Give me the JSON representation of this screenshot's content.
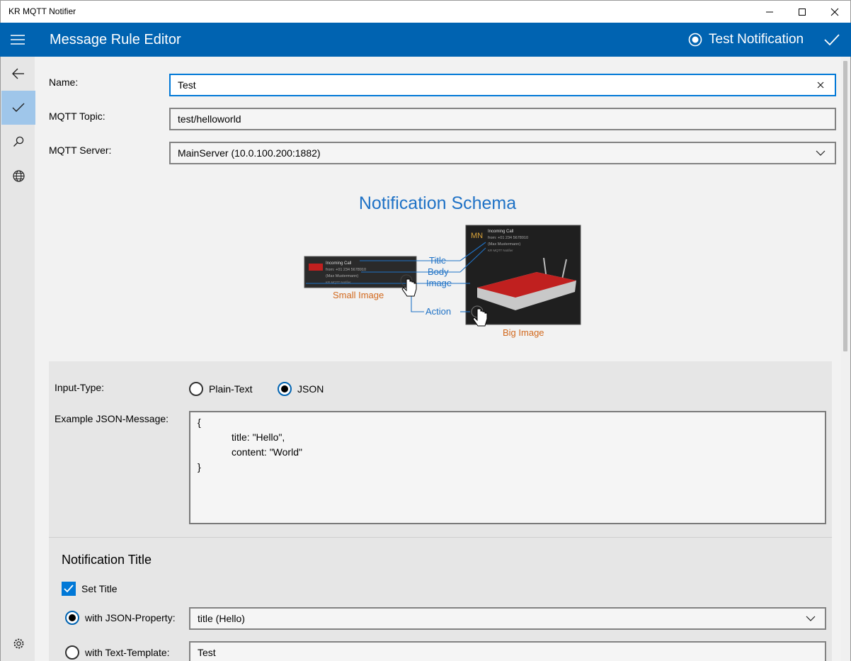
{
  "window": {
    "title": "KR MQTT Notifier"
  },
  "header": {
    "title": "Message Rule Editor",
    "test_label": "Test Notification"
  },
  "form": {
    "name_label": "Name:",
    "name_value": "Test",
    "topic_label": "MQTT Topic:",
    "topic_value": "test/helloworld",
    "server_label": "MQTT Server:",
    "server_value": "MainServer (10.0.100.200:1882)"
  },
  "schema": {
    "title": "Notification Schema",
    "small_card": {
      "title": "Incoming Call",
      "from": "from: +01 234 5678910",
      "name": "(Max Mustermann)",
      "app": "KR MQTT Notifier"
    },
    "big_card": {
      "title": "Incoming Call",
      "from": "from: +01 234 5678910",
      "name": "(Max Mustermann)",
      "app": "KR MQTT Notifier"
    },
    "labels": {
      "title": "Title",
      "body": "Body",
      "image": "Image",
      "action": "Action",
      "small_image": "Small Image",
      "big_image": "Big Image"
    },
    "colors": {
      "label": "#1f72c6",
      "caption": "#d2691e"
    }
  },
  "input": {
    "type_label": "Input-Type:",
    "option_plain": "Plain-Text",
    "option_json": "JSON",
    "selected": "JSON",
    "example_label": "Example JSON-Message:",
    "example_lines": [
      "{",
      "title: \"Hello\",",
      "content: \"World\"",
      "}"
    ]
  },
  "notification_title": {
    "heading": "Notification Title",
    "set_title_label": "Set Title",
    "set_title_checked": true,
    "json_prop_label": "with JSON-Property:",
    "json_prop_value": "title (Hello)",
    "template_label": "with Text-Template:",
    "template_value": "Test"
  },
  "colors": {
    "accent": "#0063b1",
    "header": "#0063b1",
    "nav_active": "#9fc6ea"
  }
}
